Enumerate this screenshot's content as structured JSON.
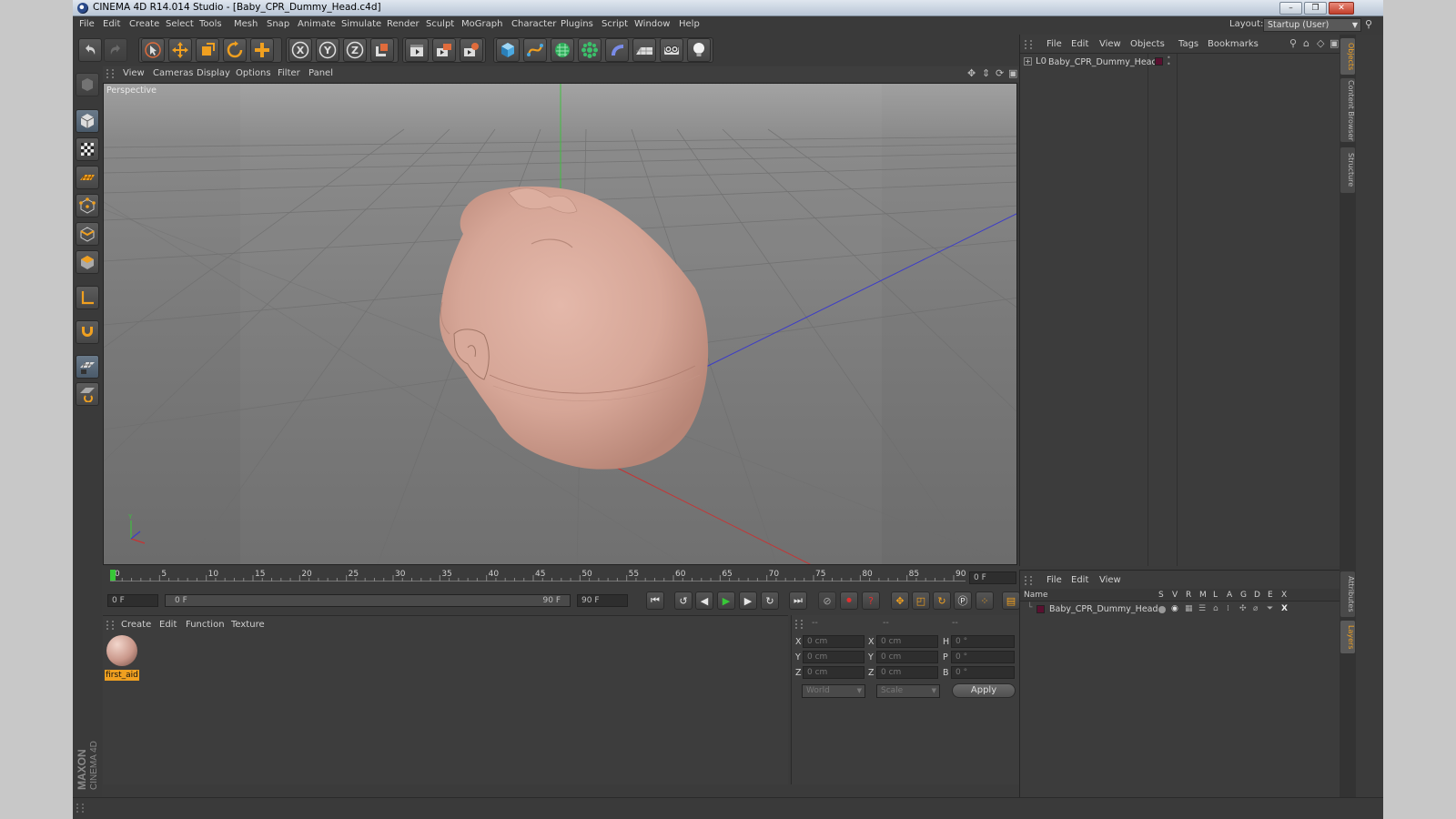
{
  "window": {
    "title": "CINEMA 4D R14.014 Studio - [Baby_CPR_Dummy_Head.c4d]",
    "minimize": "–",
    "maximize": "❐",
    "close": "✕"
  },
  "menubar": {
    "items": [
      "File",
      "Edit",
      "Create",
      "Select",
      "Tools",
      "Mesh",
      "Snap",
      "Animate",
      "Simulate",
      "Render",
      "Sculpt",
      "MoGraph",
      "Character",
      "Plugins",
      "Script",
      "Window",
      "Help"
    ],
    "layout_label": "Layout:",
    "layout_value": "Startup (User)"
  },
  "toolbar": {
    "axis_x": "X",
    "axis_y": "Y",
    "axis_z": "Z"
  },
  "viewport": {
    "menu": [
      "View",
      "Cameras",
      "Display",
      "Options",
      "Filter",
      "Panel"
    ],
    "label": "Perspective"
  },
  "timeline": {
    "ticks": [
      "0",
      "5",
      "10",
      "15",
      "20",
      "25",
      "30",
      "35",
      "40",
      "45",
      "50",
      "55",
      "60",
      "65",
      "70",
      "75",
      "80",
      "85",
      "90"
    ],
    "current_frame": "0 F"
  },
  "transport": {
    "start_field": "0 F",
    "range_start": "0 F",
    "range_end": "90 F",
    "end_field": "90 F"
  },
  "materials": {
    "menu": [
      "Create",
      "Edit",
      "Function",
      "Texture"
    ],
    "items": [
      {
        "name": "first_aid"
      }
    ]
  },
  "coordinates": {
    "header": [
      "--",
      "--",
      "--"
    ],
    "rows": [
      {
        "l1": "X",
        "v1": "0 cm",
        "l2": "X",
        "v2": "0 cm",
        "l3": "H",
        "v3": "0 °"
      },
      {
        "l1": "Y",
        "v1": "0 cm",
        "l2": "Y",
        "v2": "0 cm",
        "l3": "P",
        "v3": "0 °"
      },
      {
        "l1": "Z",
        "v1": "0 cm",
        "l2": "Z",
        "v2": "0 cm",
        "l3": "B",
        "v3": "0 °"
      }
    ],
    "space_select": "World",
    "mode_select": "Scale",
    "apply_label": "Apply"
  },
  "objects_panel": {
    "menu": [
      "File",
      "Edit",
      "View",
      "Objects",
      "Tags",
      "Bookmarks"
    ],
    "objects": [
      {
        "name": "Baby_CPR_Dummy_Head"
      }
    ]
  },
  "layers_panel": {
    "menu": [
      "File",
      "Edit",
      "View"
    ],
    "columns": [
      "Name",
      "S",
      "V",
      "R",
      "M",
      "L",
      "A",
      "G",
      "D",
      "E",
      "X"
    ],
    "rows": [
      {
        "name": "Baby_CPR_Dummy_Head"
      }
    ]
  },
  "sidetabs": [
    "Objects",
    "Content Browser",
    "Structure",
    "Attributes",
    "Layers"
  ],
  "branding": {
    "logo": "MAXON CINEMA 4D"
  },
  "colors": {
    "accent_orange": "#f0a020",
    "timeline_marker": "#38c838",
    "skin": "#d9aa9c",
    "y_axis": "#3fbf3f",
    "x_axis": "#c83232",
    "z_axis": "#3c3cc8"
  }
}
